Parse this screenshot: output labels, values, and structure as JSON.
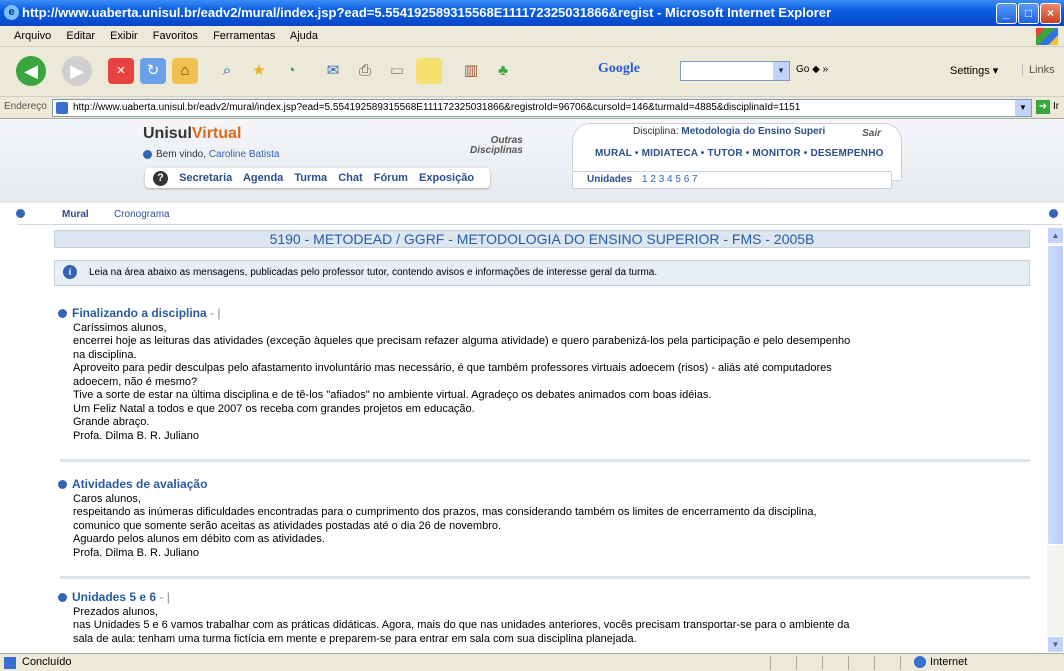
{
  "window": {
    "title": "http://www.uaberta.unisul.br/eadv2/mural/index.jsp?ead=5.554192589315568E111172325031866&regist - Microsoft Internet Explorer"
  },
  "menu": [
    "Arquivo",
    "Editar",
    "Exibir",
    "Favoritos",
    "Ferramentas",
    "Ajuda"
  ],
  "toolbar": {
    "google_label": "Google",
    "go": "Go",
    "settings": "Settings",
    "links": "Links"
  },
  "address": {
    "label": "Endereço",
    "url": "http://www.uaberta.unisul.br/eadv2/mural/index.jsp?ead=5.554192589315568E111172325031866&registroId=96706&cursoId=146&turmaId=4885&disciplinaId=1151",
    "go": "Ir"
  },
  "header": {
    "logo_a": "Unisul",
    "logo_b": "Virtual",
    "welcome": "Bem vindo,",
    "user": "Caroline Batista",
    "outras": "Outras",
    "disciplinas": "Disciplinas",
    "disciplina_label": "Disciplina:",
    "disciplina": "Metodologia do Ensino Superi",
    "sair": "Sair",
    "links": "MURAL  •  MIDIATECA  •  TUTOR  •  MONITOR  •  DESEMPENHO",
    "units_label": "Unidades",
    "units": "1 2 3 4 5 6 7",
    "nav": [
      "Secretaria",
      "Agenda",
      "Turma",
      "Chat",
      "Fórum",
      "Exposição"
    ],
    "help": "?"
  },
  "tabs": {
    "mural": "Mural",
    "cronograma": "Cronograma"
  },
  "course_title": "5190 - METODEAD / GGRF - METODOLOGIA DO ENSINO SUPERIOR - FMS - 2005B",
  "info_text": "Leia na área abaixo as mensagens, publicadas pelo professor tutor, contendo avisos e informações de interesse geral da turma.",
  "posts": [
    {
      "title": "Finalizando a disciplina",
      "sep": " - |",
      "body": "Caríssimos alunos,\nencerrei hoje as leituras das atividades (exceção àqueles que precisam refazer alguma atividade) e quero parabenizá-los pela participação e pelo desempenho\nna disciplina.\nAproveito para pedir desculpas pelo afastamento involuntário mas necessário, é que também professores virtuais adoecem (risos) - aliás até computadores\nadoecem, não é mesmo?\nTive a sorte de estar na última disciplina e de tê-los \"afiados\" no ambiente virtual. Agradeço os debates animados com boas idéias.\nUm Feliz Natal a todos e que 2007 os receba com grandes projetos em educação.\nGrande abraço.\nProfa. Dilma B. R. Juliano"
    },
    {
      "title": "Atividades de avaliação",
      "sep": "",
      "body": "Caros alunos,\nrespeitando as inúmeras dificuldades encontradas para o cumprimento dos prazos, mas considerando também os limites de encerramento da disciplina,\ncomunico que somente serão aceitas as atividades postadas até o dia 26 de novembro.\nAguardo pelos alunos em débito com as atividades.\nProfa. Dilma B. R. Juliano"
    },
    {
      "title": "Unidades 5 e 6",
      "sep": " - |",
      "body": "Prezados alunos,\nnas Unidades 5 e 6 vamos trabalhar com as práticas didáticas. Agora, mais do que nas unidades anteriores, vocês precisam transportar-se para o ambiente da\nsala de aula: tenham uma turma fictícia em mente e preparem-se para entrar em sala com sua disciplina planejada."
    }
  ],
  "status": {
    "text": "Concluído",
    "zone": "Internet"
  }
}
